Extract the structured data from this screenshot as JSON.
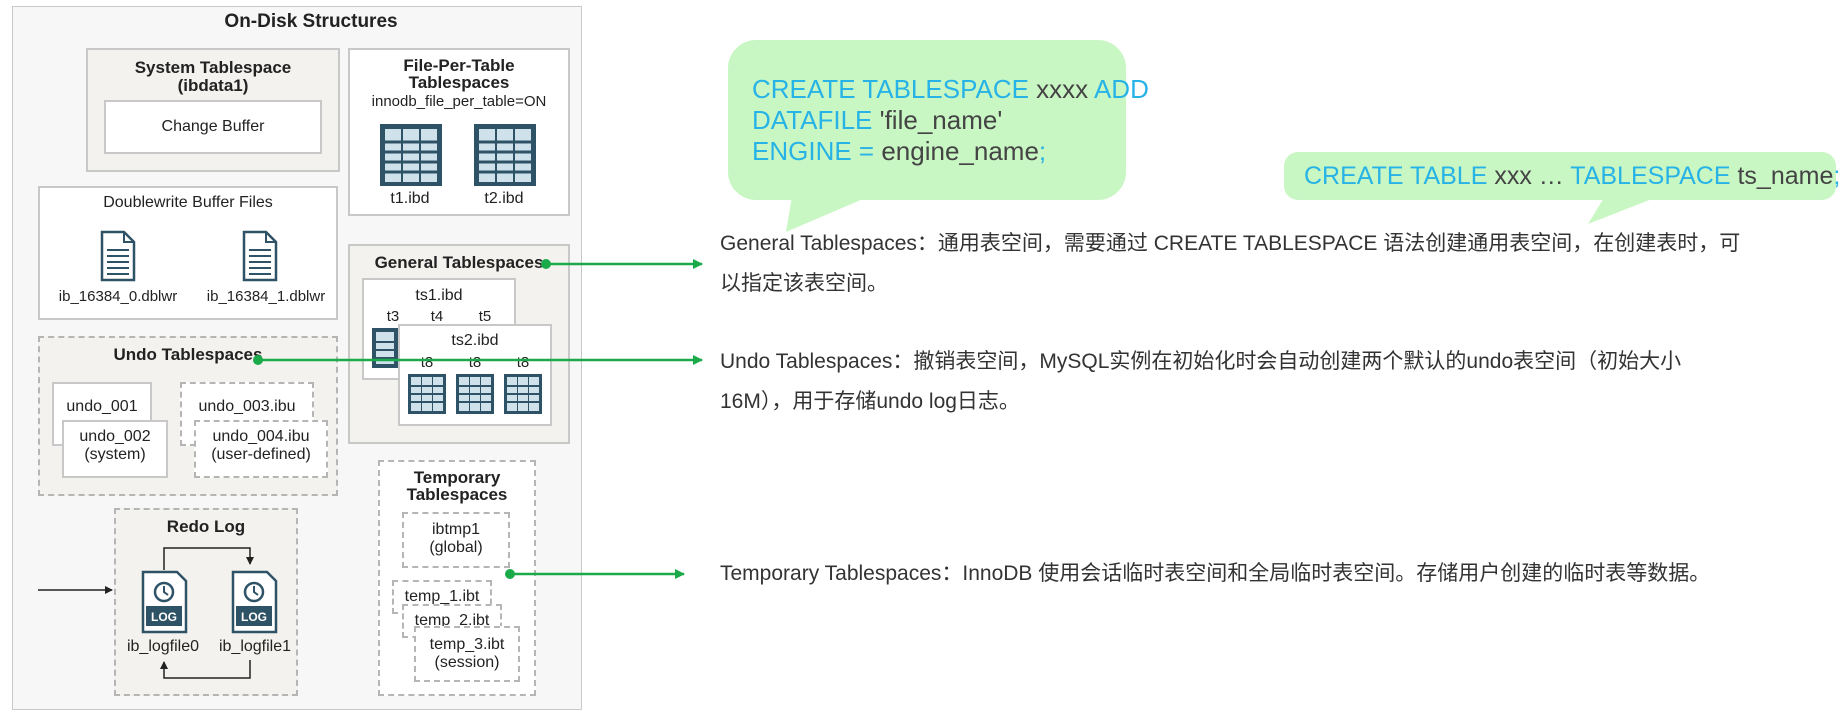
{
  "diagram": {
    "title": "On-Disk Structures",
    "system_tablespace": {
      "title": "System Tablespace",
      "subtitle": "(ibdata1)",
      "change_buffer": "Change Buffer"
    },
    "file_per_table": {
      "title_line1": "File-Per-Table",
      "title_line2": "Tablespaces",
      "setting": "innodb_file_per_table=ON",
      "files": [
        "t1.ibd",
        "t2.ibd"
      ]
    },
    "doublewrite": {
      "title": "Doublewrite Buffer Files",
      "files": [
        "ib_16384_0.dblwr",
        "ib_16384_1.dblwr"
      ]
    },
    "general": {
      "title": "General Tablespaces",
      "ts1": "ts1.ibd",
      "ts1_tables": [
        "t3",
        "t4",
        "t5"
      ],
      "ts2": "ts2.ibd",
      "ts2_tables": [
        "t8",
        "t8",
        "t8"
      ]
    },
    "undo": {
      "title": "Undo Tablespaces",
      "u1": "undo_001",
      "u2_line1": "undo_002",
      "u2_line2": "(system)",
      "u3": "undo_003.ibu",
      "u4_line1": "undo_004.ibu",
      "u4_line2": "(user-defined)"
    },
    "temporary": {
      "title_line1": "Temporary",
      "title_line2": "Tablespaces",
      "ibtmp_line1": "ibtmp1",
      "ibtmp_line2": "(global)",
      "temp1": "temp_1.ibt",
      "temp2": "temp_2.ibt",
      "temp3": "temp_3.ibt",
      "temp3_sub": "(session)"
    },
    "redo": {
      "title": "Redo Log",
      "icon_text": "LOG",
      "files": [
        "ib_logfile0",
        "ib_logfile1"
      ]
    }
  },
  "bubbles": {
    "create_tablespace": {
      "l1_kw": "CREATE TABLESPACE",
      "l1_var": " xxxx ",
      "l1_kw2": " ADD",
      "l2_kw": "DATAFILE",
      "l2_var": "  'file_name'",
      "l3_kw": "ENGINE = ",
      "l3_var": "engine_name",
      "l3_end": ";"
    },
    "create_table": {
      "kw1": "CREATE  TABLE ",
      "var1": " xxx … ",
      "kw2": " TABLESPACE ",
      "var2": " ts_name",
      "end": ";"
    }
  },
  "descriptions": {
    "general_l1": "General Tablespaces：通用表空间，需要通过 CREATE  TABLESPACE 语法创建通用表空间，在创建表时，可",
    "general_l2": "以指定该表空间。",
    "undo_l1": "Undo Tablespaces：撤销表空间，MySQL实例在初始化时会自动创建两个默认的undo表空间（初始大小",
    "undo_l2": "16M），用于存储undo log日志。",
    "temporary_l1": "Temporary Tablespaces：InnoDB 使用会话临时表空间和全局临时表空间。存储用户创建的临时表等数据。"
  },
  "colors": {
    "arrow": "#1aaa4a",
    "bubble": "#c9f7c4",
    "code": "#27b3e6",
    "icon": "#2f5366"
  }
}
